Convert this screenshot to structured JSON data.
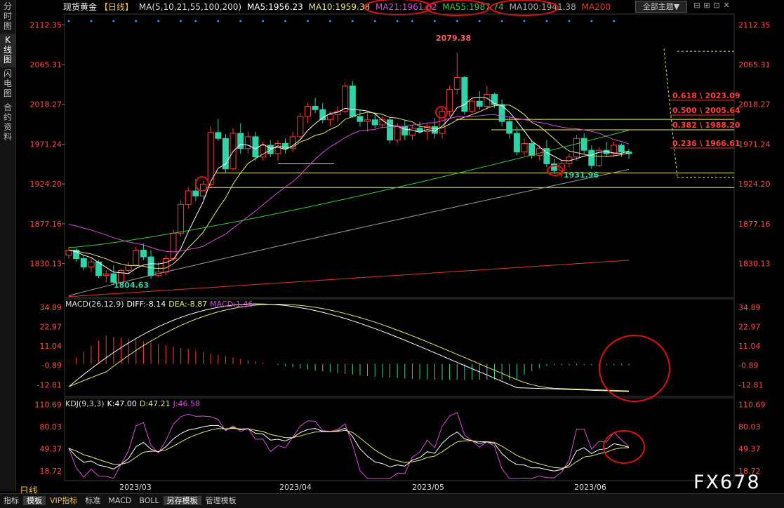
{
  "sidebar": {
    "tabs": [
      "分\n时\n图",
      "K\n线\n图",
      "闪\n电\n图",
      "合\n约\n资\n料"
    ],
    "active_index": 1
  },
  "header": {
    "title": "现货黄金",
    "period_tag": "【日线】",
    "ma_params": "MA(5,10,21,55,100,200)",
    "ma5": "MA5:1956.23",
    "ma10": "MA10:1959.38",
    "ma21": "MA21:1961.62",
    "ma55": "MA55:1987.74",
    "ma100": "MA100:1941.38",
    "ma200": "MA200"
  },
  "theme_button": "全部主题▼",
  "window_buttons": [
    "⊟",
    "⊞",
    "⊡",
    "✕"
  ],
  "period_label": "日线",
  "watermark": "FX678",
  "bottom_tabs": [
    {
      "label": "指标"
    },
    {
      "label": "模板",
      "active": true
    },
    {
      "label": "VIP指标",
      "vip": true
    },
    {
      "label": "标准"
    },
    {
      "label": "MACD"
    },
    {
      "label": "BOLL"
    },
    {
      "label": "另存模板",
      "active": true
    },
    {
      "label": "管理模板"
    }
  ],
  "colors": {
    "up": "#ff3a3a",
    "down": "#2ed3a8",
    "ma5": "#ffffff",
    "ma10": "#e8e880",
    "ma21": "#d74fd7",
    "ma55": "#3ec83e",
    "ma100": "#9c9c9c",
    "ma200": "#e03a2a",
    "price_axis": "#ff4d4d",
    "ref_line": "#f0f050",
    "annotation_circle": "#e01010"
  },
  "chart_data": [
    {
      "type": "candlestick",
      "title": "现货黄金 日线",
      "ylim": [
        1790,
        2125
      ],
      "yticks": [
        2112.35,
        2065.31,
        2018.27,
        1971.24,
        1924.2,
        1877.16,
        1830.13
      ],
      "ytick_labels": [
        "2112.35",
        "2065.31",
        "2018.27",
        "1971.24",
        "1924.20",
        "1877.16",
        "1830.13"
      ],
      "xticks": [
        "2023/03",
        "2023/04",
        "2023/05",
        "2023/06"
      ],
      "annotations": [
        {
          "label": "2079.38",
          "type": "high"
        },
        {
          "label": "1931.96",
          "type": "low"
        },
        {
          "label": "1804.63",
          "type": "low"
        }
      ],
      "fib_levels": [
        {
          "label": "0.618 \\ 2023.09",
          "value": 2023.09
        },
        {
          "label": "0.500 \\ 2005.64",
          "value": 2005.64
        },
        {
          "label": "0.382 \\ 1988.20",
          "value": 1988.2
        },
        {
          "label": "0.236 \\ 1966.61",
          "value": 1966.61
        }
      ],
      "horizontal_lines": [
        2000.5,
        1988.2,
        1937.2,
        1920.0
      ],
      "candles": [
        [
          1840,
          1850,
          1836,
          1846
        ],
        [
          1846,
          1848,
          1832,
          1836
        ],
        [
          1836,
          1840,
          1822,
          1826
        ],
        [
          1826,
          1836,
          1820,
          1832
        ],
        [
          1832,
          1834,
          1813,
          1816
        ],
        [
          1816,
          1822,
          1808,
          1818
        ],
        [
          1818,
          1828,
          1804.63,
          1808
        ],
        [
          1808,
          1824,
          1806,
          1822
        ],
        [
          1822,
          1832,
          1818,
          1828
        ],
        [
          1828,
          1850,
          1826,
          1846
        ],
        [
          1846,
          1854,
          1834,
          1838
        ],
        [
          1838,
          1846,
          1812,
          1816
        ],
        [
          1816,
          1832,
          1814,
          1820
        ],
        [
          1820,
          1840,
          1816,
          1836
        ],
        [
          1836,
          1870,
          1834,
          1866
        ],
        [
          1866,
          1905,
          1862,
          1900
        ],
        [
          1900,
          1920,
          1895,
          1916
        ],
        [
          1916,
          1930,
          1904,
          1910
        ],
        [
          1910,
          1928,
          1906,
          1924
        ],
        [
          1924,
          1992,
          1920,
          1985
        ],
        [
          1985,
          2001,
          1975,
          1978
        ],
        [
          1978,
          1983,
          1937,
          1942
        ],
        [
          1942,
          1990,
          1940,
          1984
        ],
        [
          1984,
          1996,
          1960,
          1966
        ],
        [
          1966,
          1986,
          1960,
          1980
        ],
        [
          1980,
          1986,
          1952,
          1956
        ],
        [
          1956,
          1974,
          1952,
          1970
        ],
        [
          1970,
          1976,
          1956,
          1960
        ],
        [
          1960,
          1976,
          1952,
          1972
        ],
        [
          1972,
          1978,
          1960,
          1966
        ],
        [
          1966,
          1986,
          1962,
          1980
        ],
        [
          1980,
          2008,
          1978,
          2004
        ],
        [
          2004,
          2020,
          1996,
          2016
        ],
        [
          2016,
          2026,
          2008,
          2012
        ],
        [
          2012,
          2020,
          1996,
          2000
        ],
        [
          2000,
          2010,
          1992,
          2006
        ],
        [
          2006,
          2016,
          1998,
          2010
        ],
        [
          2010,
          2044,
          2008,
          2040
        ],
        [
          2040,
          2046,
          2002,
          2004
        ],
        [
          2004,
          2012,
          1992,
          1998
        ],
        [
          1998,
          2008,
          1986,
          2000
        ],
        [
          2000,
          2006,
          1990,
          1994
        ],
        [
          1994,
          2004,
          1990,
          2000
        ],
        [
          2000,
          2002,
          1972,
          1976
        ],
        [
          1976,
          1996,
          1972,
          1992
        ],
        [
          1992,
          2000,
          1976,
          1982
        ],
        [
          1982,
          1994,
          1976,
          1990
        ],
        [
          1990,
          1998,
          1984,
          1986
        ],
        [
          1986,
          1996,
          1976,
          1992
        ],
        [
          1992,
          2002,
          1978,
          1984
        ],
        [
          1984,
          2014,
          1978,
          2010
        ],
        [
          2010,
          2040,
          2004,
          2036
        ],
        [
          2036,
          2079.38,
          2030,
          2050
        ],
        [
          2050,
          2052,
          2006,
          2010
        ],
        [
          2010,
          2024,
          2008,
          2022
        ],
        [
          2022,
          2034,
          2012,
          2016
        ],
        [
          2016,
          2040,
          2012,
          2030
        ],
        [
          2030,
          2032,
          2014,
          2018
        ],
        [
          2018,
          2024,
          1992,
          1998
        ],
        [
          1998,
          2004,
          1978,
          1984
        ],
        [
          1984,
          1992,
          1958,
          1962
        ],
        [
          1962,
          1978,
          1958,
          1972
        ],
        [
          1972,
          1976,
          1954,
          1958
        ],
        [
          1958,
          1970,
          1952,
          1966
        ],
        [
          1966,
          1976,
          1944,
          1948
        ],
        [
          1948,
          1954,
          1936,
          1940
        ],
        [
          1940,
          1952,
          1931.96,
          1948
        ],
        [
          1948,
          1960,
          1944,
          1956
        ],
        [
          1956,
          1982,
          1952,
          1978
        ],
        [
          1978,
          1984,
          1960,
          1964
        ],
        [
          1964,
          1970,
          1942,
          1946
        ],
        [
          1946,
          1968,
          1944,
          1964
        ],
        [
          1964,
          1974,
          1956,
          1960
        ],
        [
          1960,
          1974,
          1956,
          1970
        ],
        [
          1970,
          1972,
          1956,
          1962
        ],
        [
          1962,
          1966,
          1954,
          1960
        ]
      ]
    },
    {
      "type": "macd",
      "title": "MACD(26,12,9)",
      "diff_label": "DIFF:-8.14",
      "dea_label": "DEA:-8.87",
      "macd_label": "MACD:1.46",
      "ylim": [
        -20,
        40
      ],
      "yticks": [
        34.89,
        22.97,
        11.04,
        -0.89,
        -12.81
      ],
      "ytick_labels": [
        "34.89",
        "22.97",
        "11.04",
        "-0.89",
        "-12.81"
      ]
    },
    {
      "type": "kdj",
      "title": "KDJ(9,3,3)",
      "k_label": "K:47.00",
      "d_label": "D:47.21",
      "j_label": "J:46.58",
      "ylim": [
        5,
        120
      ],
      "yticks": [
        110.69,
        80.03,
        49.37,
        18.72
      ],
      "ytick_labels": [
        "110.69",
        "80.03",
        "49.37",
        "18.72"
      ]
    }
  ]
}
